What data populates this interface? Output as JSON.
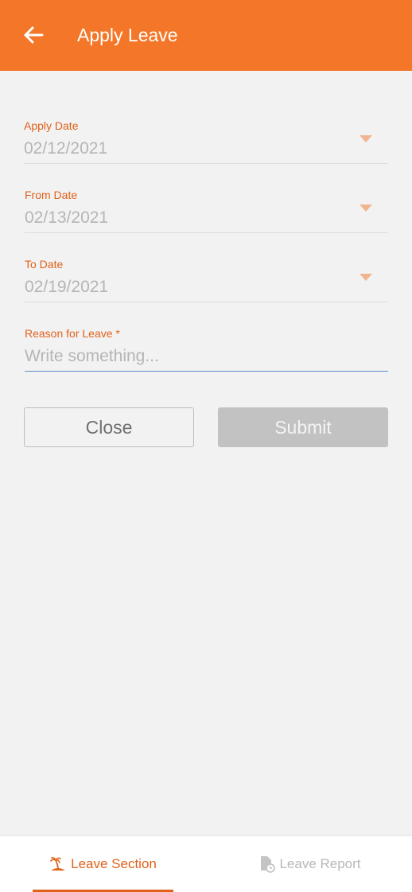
{
  "appbar": {
    "title": "Apply Leave",
    "back_icon": "arrow-left-icon",
    "color": "#f47628"
  },
  "form": {
    "apply_date": {
      "label": "Apply Date",
      "value": "02/12/2021"
    },
    "from_date": {
      "label": "From Date",
      "value": "02/13/2021"
    },
    "to_date": {
      "label": "To Date",
      "value": "02/19/2021"
    },
    "reason": {
      "label": "Reason for Leave *",
      "placeholder": "Write something...",
      "value": ""
    }
  },
  "buttons": {
    "close_label": "Close",
    "submit_label": "Submit"
  },
  "bottom_nav": {
    "items": [
      {
        "label": "Leave Section",
        "icon": "island-icon",
        "active": true
      },
      {
        "label": "Leave Report",
        "icon": "report-document-icon",
        "active": false
      }
    ],
    "accent": "#e0621a"
  }
}
